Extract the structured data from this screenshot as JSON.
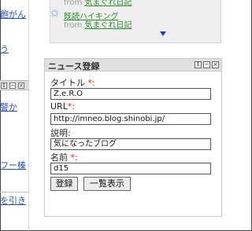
{
  "left_column": {
    "link_1": "飽がん",
    "link_2": "う",
    "link_3": "警か",
    "link_4": "フー榛",
    "link_5": "を引き"
  },
  "top_widget": {
    "item_1_title_partial": "",
    "item_1_from": "from",
    "item_1_source": "気まぐれ日記",
    "item_2_title": "既読ハイキング",
    "item_2_from": "from",
    "item_2_source": "気まぐれ日記"
  },
  "news_form": {
    "title": "ニュース登録",
    "fields": {
      "title_label": "タイトル",
      "title_value": "Z.e.R.O",
      "url_label": "URL",
      "url_value": "http://imneo.blog.shinobi.jp/",
      "desc_label": "説明:",
      "desc_value": "気になったブログ",
      "name_label": "名前",
      "name_value": "d15"
    },
    "required_mark": "*:",
    "buttons": {
      "register": "登録",
      "list": "一覧表示"
    }
  }
}
